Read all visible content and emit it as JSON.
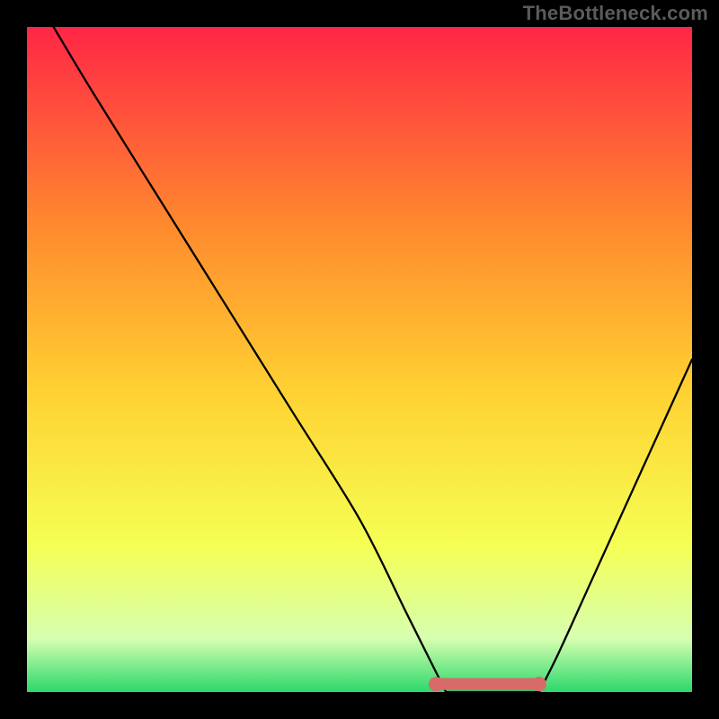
{
  "watermark": "TheBottleneck.com",
  "chart_data": {
    "type": "line",
    "title": "",
    "xlabel": "",
    "ylabel": "",
    "xlim": [
      0,
      100
    ],
    "ylim": [
      0,
      100
    ],
    "background_gradient": {
      "top": "#ff2646",
      "upper_mid": "#ff8a2e",
      "mid": "#ffd232",
      "lower_mid": "#f5ff54",
      "low": "#d6ffb0",
      "bottom": "#2bd86b"
    },
    "series": [
      {
        "name": "bottleneck-curve-left",
        "x": [
          4,
          10,
          20,
          30,
          40,
          50,
          57,
          61,
          63
        ],
        "y": [
          100,
          90,
          74,
          58,
          42,
          26,
          12,
          4,
          0
        ]
      },
      {
        "name": "bottleneck-curve-right",
        "x": [
          77,
          80,
          85,
          90,
          95,
          100
        ],
        "y": [
          0,
          6,
          17,
          28,
          39,
          50
        ]
      },
      {
        "name": "flat-segment",
        "x": [
          63,
          65,
          68,
          71,
          74,
          77
        ],
        "y": [
          0,
          0,
          0,
          0,
          0,
          0
        ]
      }
    ],
    "highlight_band": {
      "name": "ideal-range-marker",
      "color": "#d86a6a",
      "x": [
        61.5,
        77
      ],
      "y": [
        1.2,
        1.2
      ],
      "thickness_pct": 1.8,
      "endpoint_radius_pct": 1.1
    }
  }
}
